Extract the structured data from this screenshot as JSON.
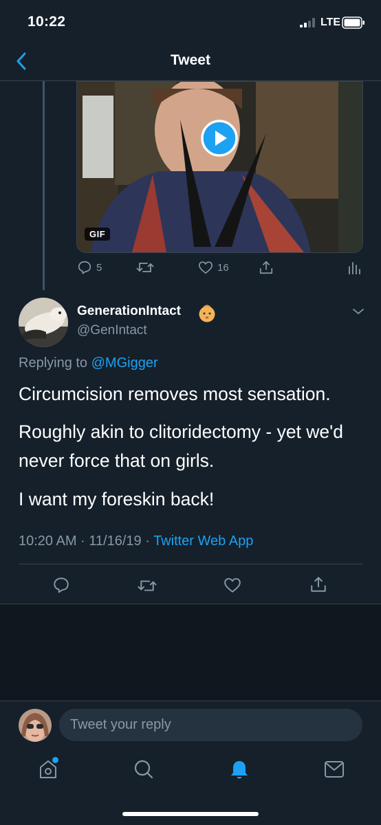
{
  "status_bar": {
    "time": "10:22",
    "carrier": "LTE"
  },
  "nav": {
    "title": "Tweet"
  },
  "parent_tweet": {
    "gif_badge": "GIF",
    "reply_count": "5",
    "like_count": "16"
  },
  "tweet": {
    "display_name": "GenerationIntact",
    "handle": "@GenIntact",
    "replying_prefix": "Replying to ",
    "replying_to": "@MGigger",
    "paragraphs": [
      "Circumcision removes most sensation.",
      "Roughly akin to clitoridectomy - yet we'd never force that on girls.",
      "I want my foreskin back!"
    ],
    "time": "10:20 AM · 11/16/19 · ",
    "source": "Twitter Web App"
  },
  "composer": {
    "placeholder": "Tweet your reply"
  },
  "icons": {
    "reply": "reply-icon",
    "retweet": "retweet-icon",
    "like": "heart-icon",
    "share": "share-icon",
    "analytics": "analytics-icon",
    "home": "home-icon",
    "search": "search-icon",
    "notifications": "bell-icon",
    "messages": "mail-icon"
  },
  "colors": {
    "background": "#15202b",
    "accent": "#1da1f2",
    "muted": "#8899a6",
    "divider": "#38444d"
  }
}
